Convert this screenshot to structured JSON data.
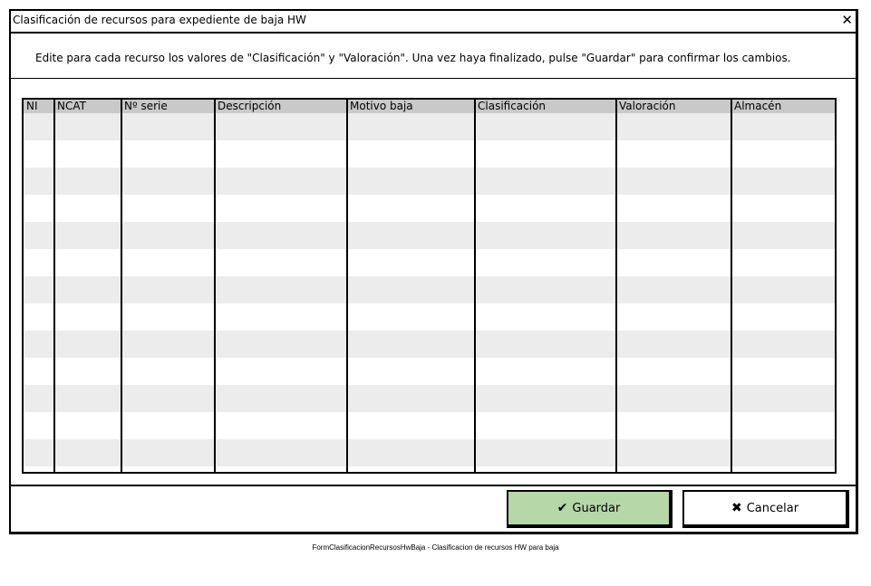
{
  "window": {
    "title": "Clasificación de recursos para expediente de baja HW",
    "close_icon": "✕"
  },
  "instructions": "Edite para cada recurso los valores de \"Clasificación\" y \"Valoración\". Una vez haya finalizado, pulse \"Guardar\" para confirmar los cambios.",
  "table": {
    "columns": [
      "NI",
      "NCAT",
      "Nº serie",
      "Descripción",
      "Motivo baja",
      "Clasificación",
      "Valoración",
      "Almacén"
    ],
    "rows": []
  },
  "buttons": {
    "save_label": "Guardar",
    "save_icon": "check-icon",
    "cancel_label": "Cancelar",
    "cancel_icon": "close-icon"
  },
  "colors": {
    "save_button": "#b6d7a8",
    "header_bg": "#c9c9c9",
    "alt_row": "#ececec"
  },
  "caption": "FormClasificacionRecursosHwBaja - Clasificacion de recursos HW para baja"
}
